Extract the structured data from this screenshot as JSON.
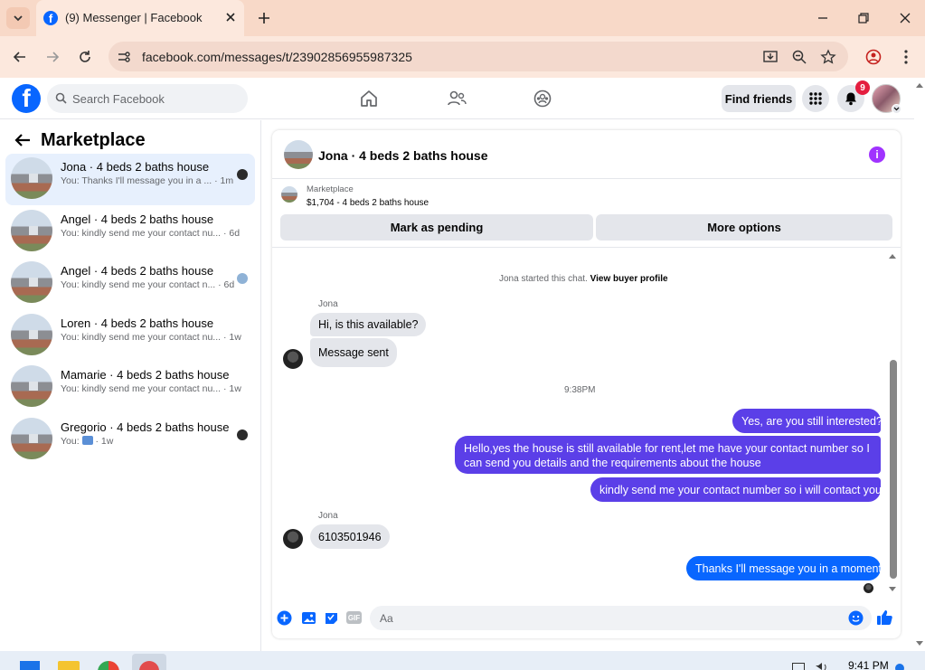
{
  "browser": {
    "tab_title": "(9) Messenger | Facebook",
    "url": "facebook.com/messages/t/23902856955987325"
  },
  "fb": {
    "search_placeholder": "Search Facebook",
    "find_friends": "Find friends",
    "notif_count": "9"
  },
  "sidebar": {
    "title": "Marketplace",
    "conversations": [
      {
        "name": "Jona · 4 beds 2 baths house",
        "preview": "You: Thanks I'll message you in a ...",
        "time": "· 1m",
        "active": true
      },
      {
        "name": "Angel · 4 beds 2 baths house",
        "preview": "You: kindly send me your contact nu...",
        "time": "· 6d"
      },
      {
        "name": "Angel · 4 beds 2 baths house",
        "preview": "You: kindly send me your contact n...",
        "time": "· 6d"
      },
      {
        "name": "Loren · 4 beds 2 baths house",
        "preview": "You: kindly send me your contact nu...",
        "time": "· 1w"
      },
      {
        "name": "Mamarie · 4 beds 2 baths house",
        "preview": "You: kindly send me your contact nu...",
        "time": "· 1w"
      },
      {
        "name": "Gregorio · 4 beds 2 baths house",
        "preview": "You:",
        "time": "· 1w"
      }
    ]
  },
  "chat": {
    "title": "Jona · 4 beds 2 baths house",
    "marketplace_label": "Marketplace",
    "listing": "$1,704 - 4 beds 2 baths house",
    "mark_pending": "Mark as pending",
    "more_options": "More options",
    "started_text": "Jona started this chat.",
    "view_profile": "View buyer profile",
    "sender_name": "Jona",
    "time_divider": "9:38PM",
    "messages": {
      "in1": "Hi, is this available?",
      "in2": "Message sent",
      "out1": "Yes, are you still interested?",
      "out2_line1": "Hello,yes the house is still available for rent,let me have your contact number   so I",
      "out2_line2": "can send you details and the requirements about the house",
      "out3": "kindly send me your contact number so i will contact you",
      "in3": "6103501946",
      "out4": "Thanks I'll message you in a moment"
    },
    "composer_placeholder": "Aa"
  },
  "taskbar": {
    "time": "9:41 PM"
  }
}
